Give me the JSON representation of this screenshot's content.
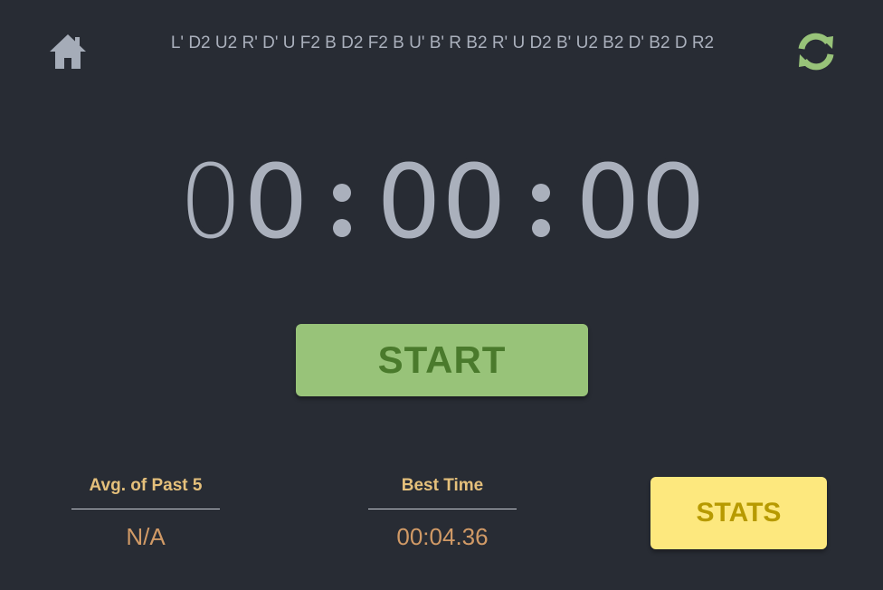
{
  "scramble": "L' D2 U2 R' D' U F2 B D2 F2 B U' B' R B2 R' U D2 B' U2 B2 D' B2 D R2",
  "timer": {
    "digits": [
      "0",
      "0",
      "0",
      "0",
      "0",
      "0"
    ],
    "separator": ":",
    "display": "00:00:00"
  },
  "start_label": "START",
  "avg": {
    "label": "Avg. of Past 5",
    "value": "N/A"
  },
  "best": {
    "label": "Best Time",
    "value": "00:04.36"
  },
  "stats_label": "STATS",
  "icons": {
    "home": "home-icon",
    "refresh": "refresh-icon"
  },
  "colors": {
    "background": "#282c34",
    "scramble_text": "#aab0bc",
    "timer_text": "#aab0bc",
    "start_bg": "#98c379",
    "start_text": "#4a7a2c",
    "stat_label": "#e5c07b",
    "stat_value": "#d19a66",
    "stats_bg": "#fde87e",
    "stats_text": "#b79a00",
    "home_icon": "#a5acb8",
    "refresh_icon": "#98c379"
  }
}
